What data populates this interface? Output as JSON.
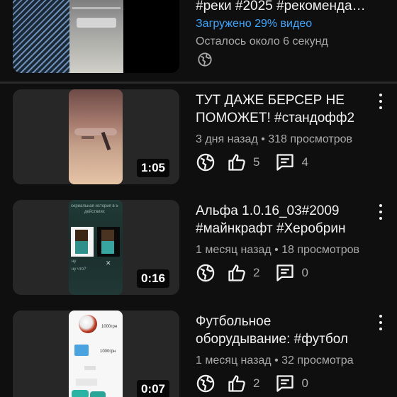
{
  "uploading": {
    "title": "#реки #2025 #рекомендации",
    "status": "Загружено 29% видео",
    "progress_percent": 29,
    "remaining": "Осталось около 6 секунд",
    "icon": "globe-icon",
    "accent_color": "#3ea6ff"
  },
  "videos": [
    {
      "title_line1": "ТУТ ДАЖЕ БЕРСЕР НЕ",
      "title_line2": "ПОМОЖЕТ! #стандофф2",
      "meta": "3 дня назад • 318 просмотров",
      "duration": "1:05",
      "likes": "5",
      "comments": "4"
    },
    {
      "title_line1": "Альфа  1.0.16_03#2009",
      "title_line2": "#майнкрафт #Херобрин",
      "meta": "1 месяц назад • 18 просмотров",
      "duration": "0:16",
      "likes": "2",
      "comments": "0",
      "thumb_text": [
        "сериальная история в 5",
        "действиях",
        "ну",
        "ну что?"
      ]
    },
    {
      "title_line1": "Футбольное",
      "title_line2": "оборудывание: #футбол",
      "meta": "1 месяц назад • 32 просмотра",
      "duration": "0:07",
      "likes": "2",
      "comments": "0",
      "thumb_text": [
        "1000грн",
        "1000грн"
      ]
    }
  ],
  "icons": {
    "visibility": "globe-icon",
    "like": "thumbs-up-icon",
    "comment": "comment-icon",
    "menu": "more-vert-icon"
  },
  "colors": {
    "background": "#0f0f0f",
    "card": "#272727",
    "secondary_text": "#aaaaaa",
    "accent": "#3ea6ff"
  }
}
